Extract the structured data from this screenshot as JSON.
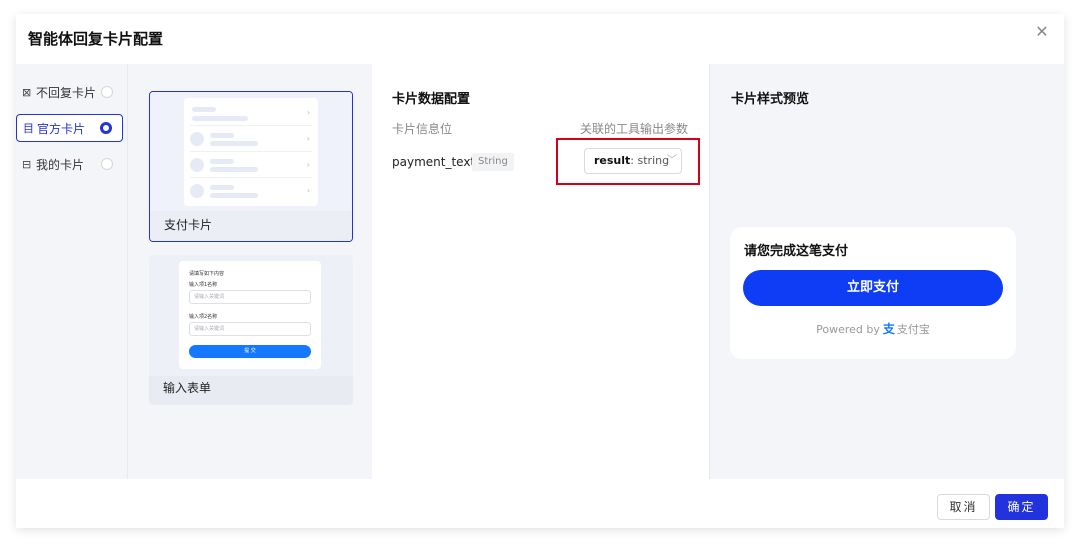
{
  "dialog": {
    "title": "智能体回复卡片配置",
    "close_symbol": "✕"
  },
  "menu": {
    "items": [
      {
        "icon": "⊠",
        "label": "不回复卡片"
      },
      {
        "icon": "目",
        "label": "官方卡片"
      },
      {
        "icon": "⊟",
        "label": "我的卡片"
      }
    ]
  },
  "cards": {
    "items": [
      {
        "name": "支付卡片"
      },
      {
        "name": "输入表单"
      }
    ],
    "form_preview": {
      "heading": "请填写如下内容",
      "field1_label": "输入项1名称",
      "field1_placeholder": "请输入关键词",
      "field2_label": "输入项2名称",
      "field2_placeholder": "请输入关键词",
      "submit": "提 交"
    }
  },
  "config": {
    "title": "卡片数据配置",
    "col_left": "卡片信息位",
    "col_right": "关联的工具输出参数",
    "field_name": "payment_text",
    "field_type": "String",
    "param_key": "result",
    "param_type": ": string"
  },
  "preview": {
    "title": "卡片样式预览",
    "pay_title": "请您完成这笔支付",
    "pay_button": "立即支付",
    "powered_by": "Powered by",
    "brand": "支付宝"
  },
  "footer": {
    "cancel": "取消",
    "ok": "确定"
  },
  "colors": {
    "accent": "#2233dd",
    "pay_button": "#0f3cf5",
    "highlight": "#d4001a"
  }
}
